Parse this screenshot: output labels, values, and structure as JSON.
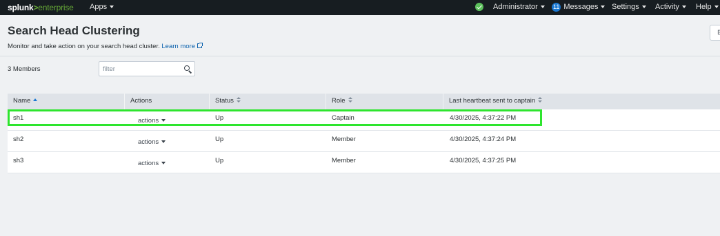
{
  "nav": {
    "logo_splunk": "splunk",
    "logo_gt": ">",
    "logo_enterprise": "enterprise",
    "apps_label": "Apps",
    "user_label": "Administrator",
    "messages_count": "11",
    "messages_label": "Messages",
    "settings_label": "Settings",
    "activity_label": "Activity",
    "help_label": "Help",
    "health_icon": "check-circle-icon",
    "health_color": "#5cc05c"
  },
  "page": {
    "title": "Search Head Clustering",
    "description": "Monitor and take action on your search head cluster.",
    "learn_more": "Learn more",
    "members_count": "3 Members",
    "filter_placeholder": "filter"
  },
  "table": {
    "columns": [
      {
        "label": "Name",
        "sort": "ascending"
      },
      {
        "label": "Actions",
        "sort": "none"
      },
      {
        "label": "Status",
        "sort": "sortable"
      },
      {
        "label": "Role",
        "sort": "sortable"
      },
      {
        "label": "Last heartbeat sent to captain",
        "sort": "sortable"
      }
    ],
    "rows": [
      {
        "name": "sh1",
        "actions": "actions",
        "status": "Up",
        "role": "Captain",
        "heartbeat": "4/30/2025, 4:37:22 PM",
        "highlighted": true
      },
      {
        "name": "sh2",
        "actions": "actions",
        "status": "Up",
        "role": "Member",
        "heartbeat": "4/30/2025, 4:37:24 PM",
        "highlighted": false
      },
      {
        "name": "sh3",
        "actions": "actions",
        "status": "Up",
        "role": "Member",
        "heartbeat": "4/30/2025, 4:37:25 PM",
        "highlighted": false
      }
    ]
  },
  "colors": {
    "nav_bg": "#171d21",
    "brand_green": "#65a637",
    "link_blue": "#0a61ad",
    "highlight_green": "#2ee52e"
  }
}
